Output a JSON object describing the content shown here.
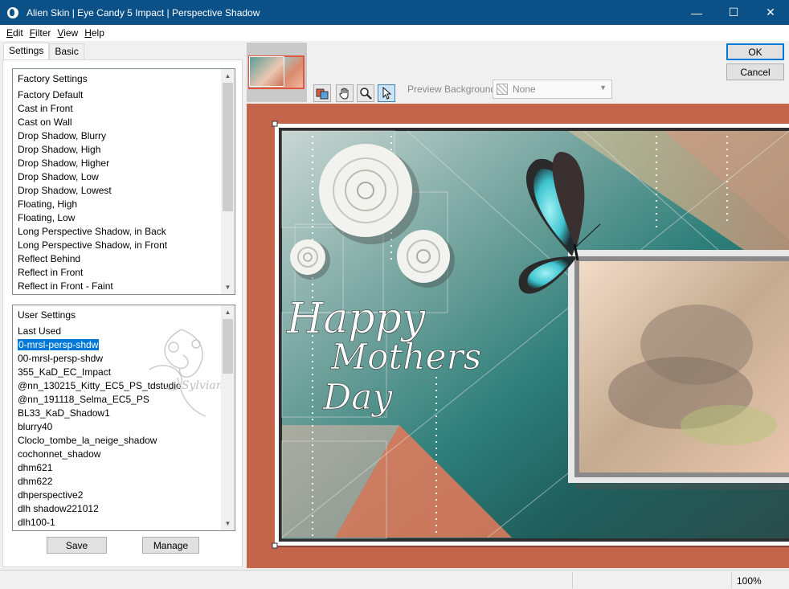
{
  "window": {
    "title": "Alien Skin | Eye Candy 5 Impact | Perspective Shadow",
    "icon": "alien-skin-icon",
    "minimize": "—",
    "maximize": "☐",
    "close": "✕"
  },
  "menu": {
    "edit_first": "E",
    "edit_rest": "dit",
    "filter_first": "F",
    "filter_rest": "ilter",
    "view_first": "V",
    "view_rest": "iew",
    "help_first": "H",
    "help_rest": "elp"
  },
  "tabs": {
    "settings": "Settings",
    "basic": "Basic"
  },
  "factory": {
    "header": "Factory Settings",
    "items": [
      "Factory Default",
      "Cast in Front",
      "Cast on Wall",
      "Drop Shadow, Blurry",
      "Drop Shadow, High",
      "Drop Shadow, Higher",
      "Drop Shadow, Low",
      "Drop Shadow, Lowest",
      "Floating, High",
      "Floating, Low",
      "Long Perspective Shadow, in Back",
      "Long Perspective Shadow, in Front",
      "Reflect Behind",
      "Reflect in Front",
      "Reflect in Front - Faint"
    ]
  },
  "user": {
    "header": "User Settings",
    "items": [
      "Last Used",
      "0-mrsl-persp-shdw",
      "00-mrsl-persp-shdw",
      "355_KaD_EC_Impact",
      "@nn_130215_Kitty_EC5_PS_tdstudio",
      "@nn_191118_Selma_EC5_PS",
      "BL33_KaD_Shadow1",
      "blurry40",
      "Cloclo_tombe_la_neige_shadow",
      "cochonnet_shadow",
      "dhm621",
      "dhm622",
      "dhperspective2",
      "dlh shadow221012",
      "dlh100-1"
    ],
    "selected_index": 1
  },
  "buttons": {
    "save": "Save",
    "manage": "Manage",
    "ok": "OK",
    "cancel": "Cancel"
  },
  "toolbar": {
    "preview_background_label": "Preview Background:",
    "preview_background_value": "None",
    "tools": [
      "toggle-preview-icon",
      "hand-icon",
      "zoom-icon",
      "pointer-icon"
    ]
  },
  "preview": {
    "watermark": "Sylviane",
    "line1": "Happy",
    "line2": "Mothers",
    "line3": "Day"
  },
  "status": {
    "zoom": "100%"
  }
}
